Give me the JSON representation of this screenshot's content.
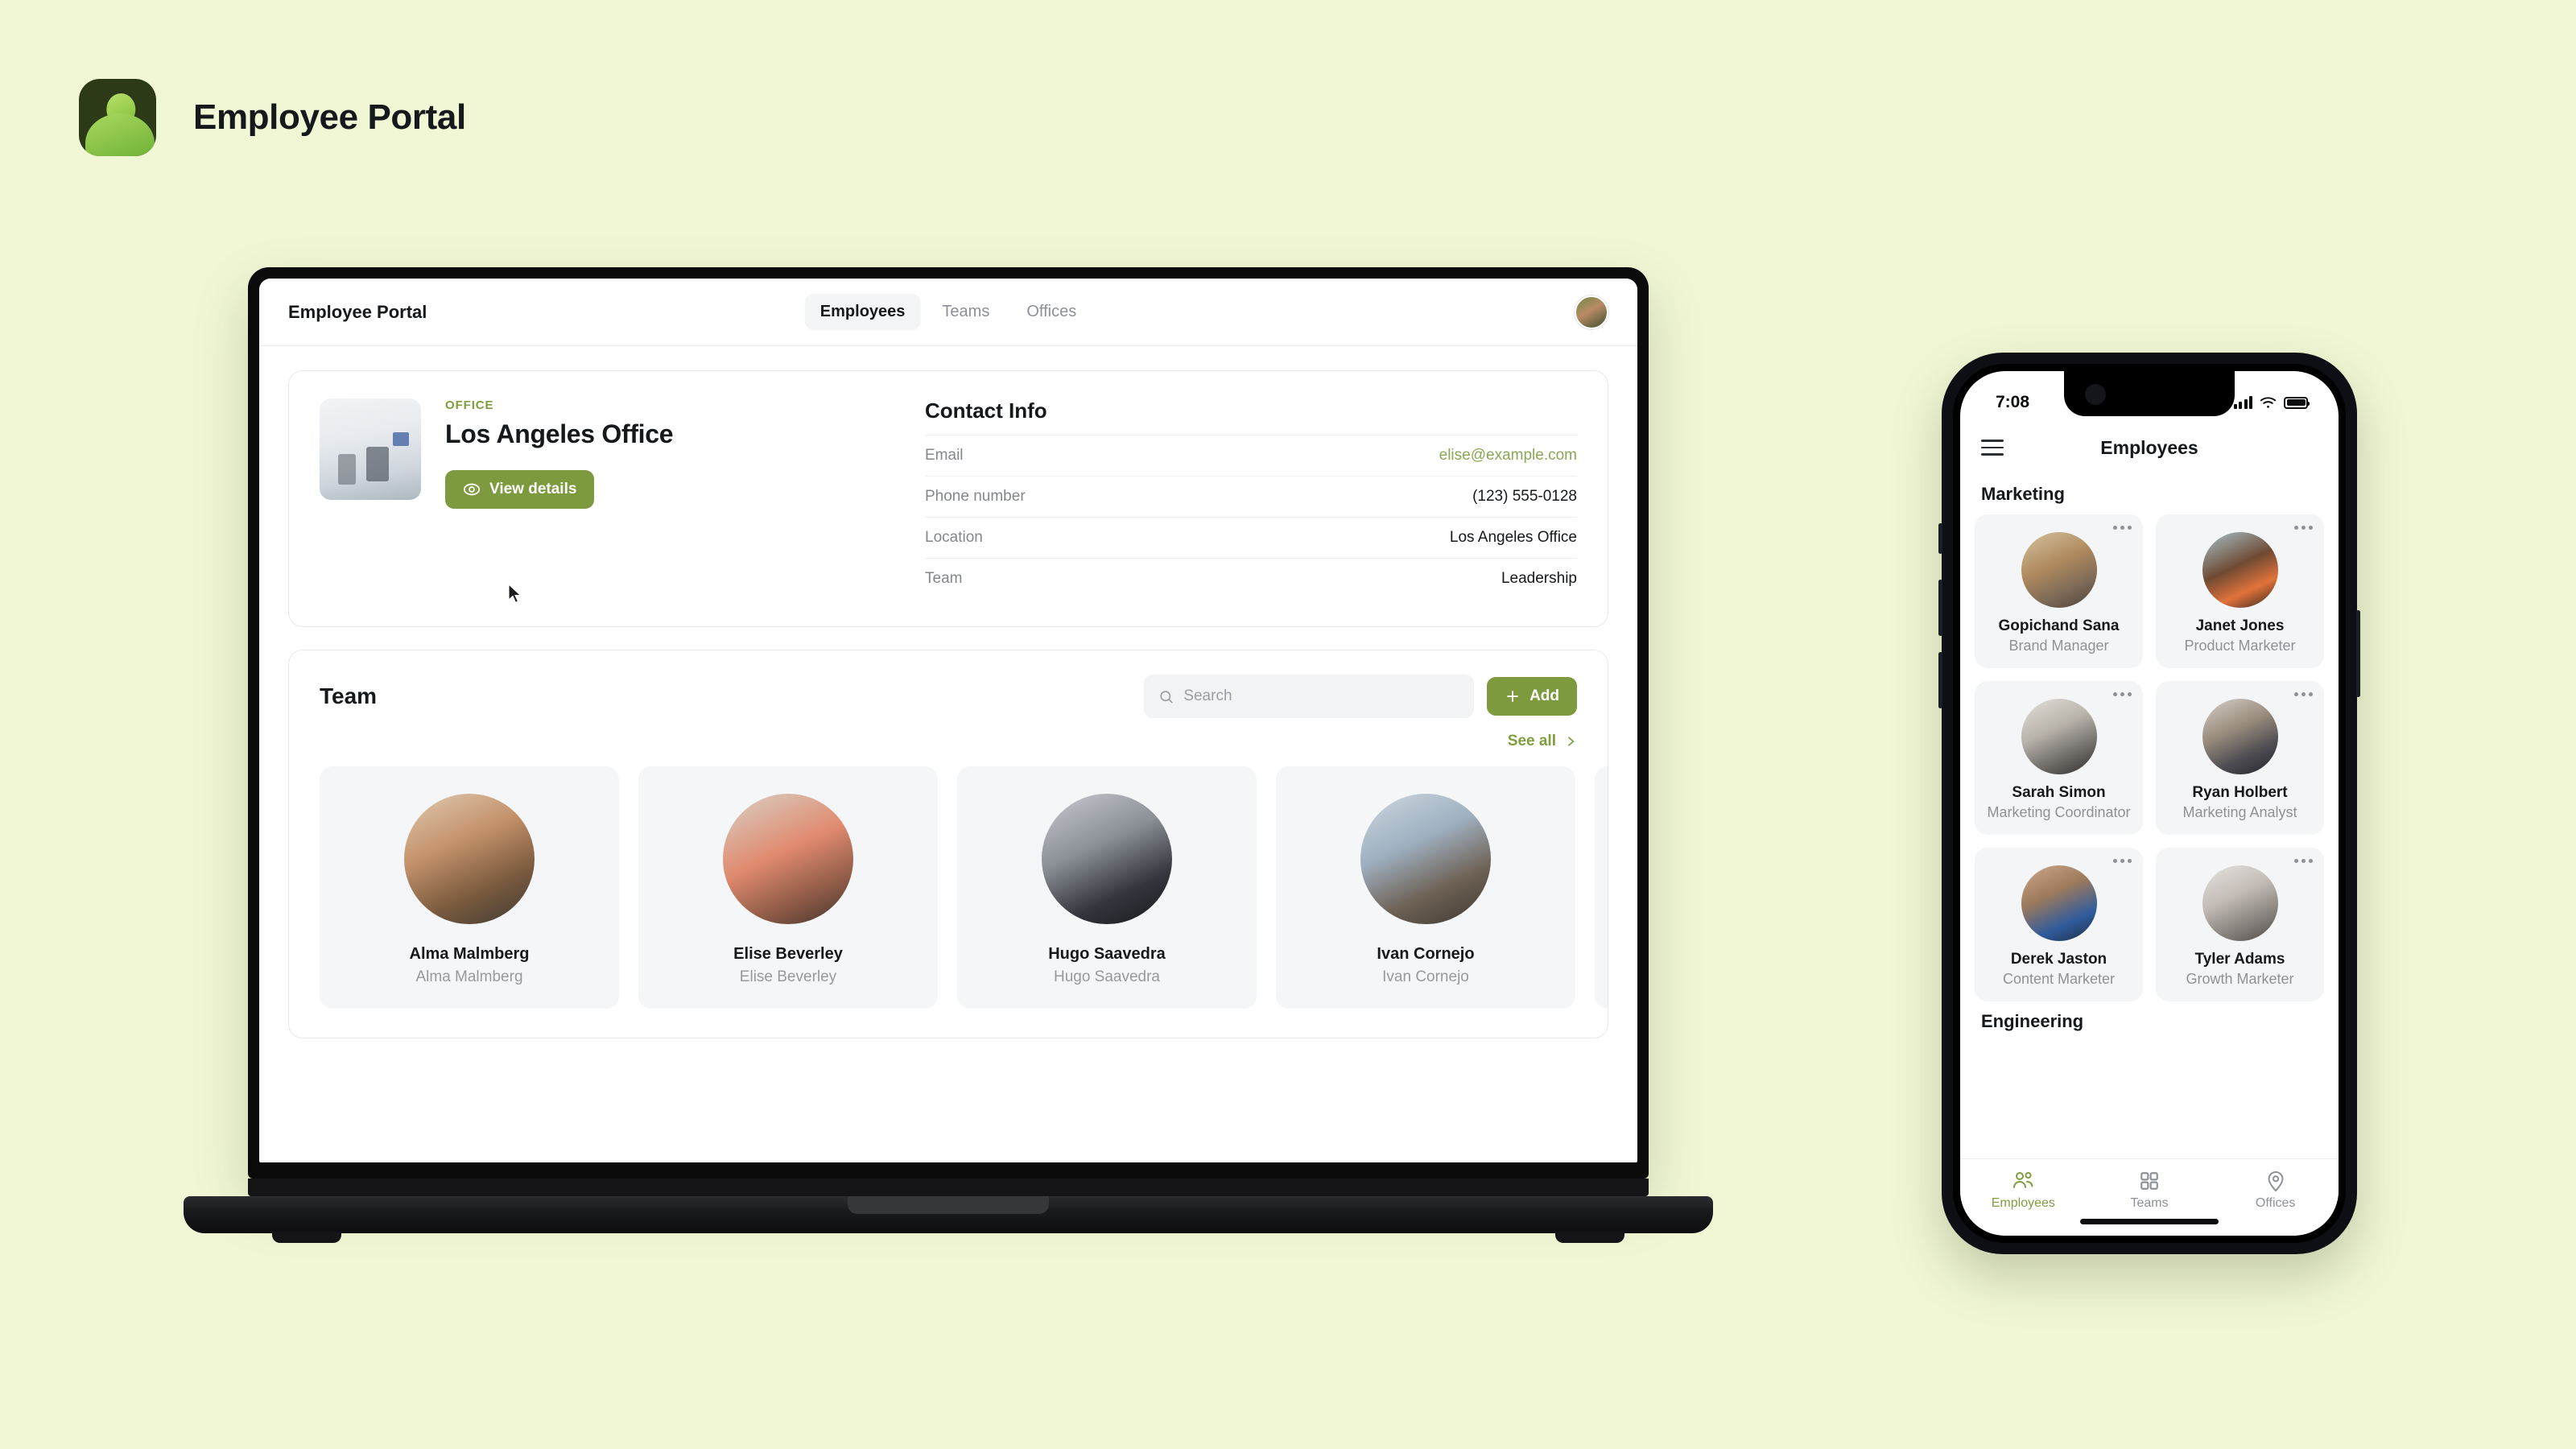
{
  "brand": {
    "title": "Employee Portal",
    "logo_icon": "person-avatar-icon",
    "accent": "#7d9b3e",
    "page_background": "#f1f7d5"
  },
  "desktop": {
    "header": {
      "title": "Employee Portal",
      "avatar_icon": "user-avatar",
      "tabs": [
        {
          "label": "Employees",
          "active": true
        },
        {
          "label": "Teams",
          "active": false
        },
        {
          "label": "Offices",
          "active": false
        }
      ]
    },
    "office_card": {
      "thumbnail_icon": "office-photo",
      "kicker": "OFFICE",
      "name": "Los Angeles Office",
      "button_label": "View details",
      "button_icon": "eye-icon"
    },
    "contact_info": {
      "heading": "Contact Info",
      "rows": [
        {
          "label": "Email",
          "value": "elise@example.com",
          "is_link": true
        },
        {
          "label": "Phone number",
          "value": "(123) 555-0128",
          "is_link": false
        },
        {
          "label": "Location",
          "value": "Los Angeles Office",
          "is_link": false
        },
        {
          "label": "Team",
          "value": "Leadership",
          "is_link": false
        }
      ]
    },
    "team_section": {
      "title": "Team",
      "search_placeholder": "Search",
      "search_value": "",
      "search_icon": "search-icon",
      "add_label": "Add",
      "add_icon": "plus-icon",
      "see_all_label": "See all",
      "see_all_icon": "chevron-right-icon",
      "members": [
        {
          "name": "Alma Malmberg",
          "subtitle": "Alma Malmberg"
        },
        {
          "name": "Elise Beverley",
          "subtitle": "Elise Beverley"
        },
        {
          "name": "Hugo Saavedra",
          "subtitle": "Hugo Saavedra"
        },
        {
          "name": "Ivan Cornejo",
          "subtitle": "Ivan Cornejo"
        },
        {
          "name": "",
          "subtitle": ""
        }
      ]
    }
  },
  "phone": {
    "status_bar": {
      "time": "7:08",
      "signal_icon": "cellular-signal-icon",
      "wifi_icon": "wifi-icon",
      "battery_icon": "battery-full-icon"
    },
    "navbar": {
      "menu_icon": "hamburger-menu-icon",
      "title": "Employees"
    },
    "sections": [
      {
        "title": "Marketing",
        "cards": [
          {
            "name": "Gopichand Sana",
            "role": "Brand Manager",
            "menu_icon": "more-horizontal-icon"
          },
          {
            "name": "Janet Jones",
            "role": "Product Marketer",
            "menu_icon": "more-horizontal-icon"
          },
          {
            "name": "Sarah Simon",
            "role": "Marketing Coordinator",
            "menu_icon": "more-horizontal-icon"
          },
          {
            "name": "Ryan Holbert",
            "role": "Marketing Analyst",
            "menu_icon": "more-horizontal-icon"
          },
          {
            "name": "Derek Jaston",
            "role": "Content Marketer",
            "menu_icon": "more-horizontal-icon"
          },
          {
            "name": "Tyler Adams",
            "role": "Growth Marketer",
            "menu_icon": "more-horizontal-icon"
          }
        ]
      },
      {
        "title": "Engineering",
        "cards": []
      }
    ],
    "tabbar": [
      {
        "label": "Employees",
        "icon": "people-icon",
        "active": true
      },
      {
        "label": "Teams",
        "icon": "grid-icon",
        "active": false
      },
      {
        "label": "Offices",
        "icon": "map-pin-icon",
        "active": false
      }
    ]
  }
}
